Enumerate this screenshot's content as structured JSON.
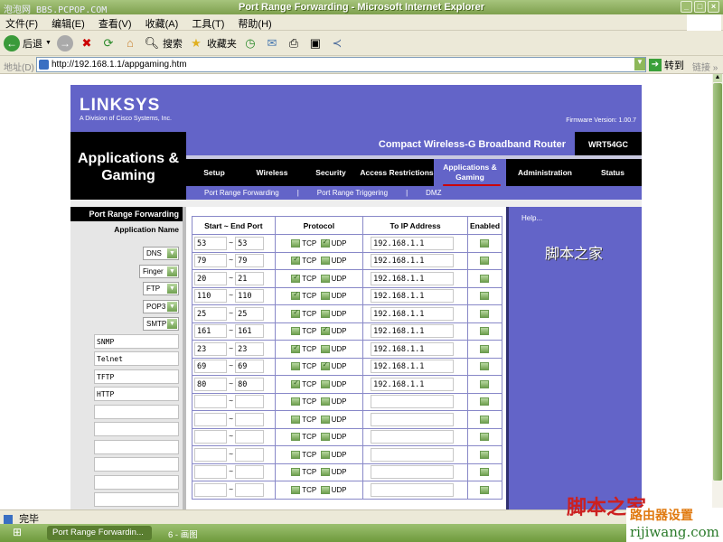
{
  "window": {
    "watermark": "泡泡网 BBS.PCPOP.COM",
    "title": "Port Range Forwarding - Microsoft Internet Explorer",
    "controls": [
      "minimize",
      "maximize",
      "close"
    ]
  },
  "menu": [
    "文件(F)",
    "编辑(E)",
    "查看(V)",
    "收藏(A)",
    "工具(T)",
    "帮助(H)"
  ],
  "toolbar": {
    "back": "后退",
    "search": "搜索",
    "favorites": "收藏夹"
  },
  "address": {
    "label": "地址(D)",
    "url": "http://192.168.1.1/appgaming.htm",
    "go": "转到",
    "links": "链接 »"
  },
  "router": {
    "logo": "LINKSYS",
    "logo_sub": "A Division of Cisco Systems, Inc.",
    "firmware": "Firmware Version: 1.00.7",
    "section_title": "Applications & Gaming",
    "product": "Compact Wireless-G Broadband Router",
    "model": "WRT54GC",
    "nav": [
      "Setup",
      "Wireless",
      "Security",
      "Access Restrictions",
      "Applications & Gaming",
      "Administration",
      "Status"
    ],
    "nav_active": "Applications & Gaming",
    "subnav": [
      "Port Range Forwarding",
      "Port Range Triggering",
      "DMZ"
    ],
    "subnav_active": "Port Range Forwarding",
    "left_header": "Port Range Forwarding",
    "app_name_label": "Application Name",
    "help": "Help...",
    "help_watermark": "脚本之家"
  },
  "table": {
    "headers": [
      "Start ~ End Port",
      "Protocol",
      "To IP Address",
      "Enabled"
    ],
    "tcp_label": "TCP",
    "udp_label": "UDP",
    "rows": [
      {
        "app": "DNS",
        "type": "select",
        "start": "53",
        "end": "53",
        "tcp": false,
        "udp": true,
        "ip": "192.168.1.1",
        "enabled": false
      },
      {
        "app": "Finger",
        "type": "select",
        "start": "79",
        "end": "79",
        "tcp": true,
        "udp": false,
        "ip": "192.168.1.1",
        "enabled": false
      },
      {
        "app": "FTP",
        "type": "select",
        "start": "20",
        "end": "21",
        "tcp": true,
        "udp": false,
        "ip": "192.168.1.1",
        "enabled": false
      },
      {
        "app": "POP3",
        "type": "select",
        "start": "110",
        "end": "110",
        "tcp": true,
        "udp": false,
        "ip": "192.168.1.1",
        "enabled": false
      },
      {
        "app": "SMTP",
        "type": "select",
        "start": "25",
        "end": "25",
        "tcp": true,
        "udp": false,
        "ip": "192.168.1.1",
        "enabled": false
      },
      {
        "app": "SNMP",
        "type": "text",
        "start": "161",
        "end": "161",
        "tcp": false,
        "udp": true,
        "ip": "192.168.1.1",
        "enabled": false
      },
      {
        "app": "Telnet",
        "type": "text",
        "start": "23",
        "end": "23",
        "tcp": true,
        "udp": false,
        "ip": "192.168.1.1",
        "enabled": false
      },
      {
        "app": "TFTP",
        "type": "text",
        "start": "69",
        "end": "69",
        "tcp": false,
        "udp": true,
        "ip": "192.168.1.1",
        "enabled": false
      },
      {
        "app": "HTTP",
        "type": "text",
        "start": "80",
        "end": "80",
        "tcp": true,
        "udp": false,
        "ip": "192.168.1.1",
        "enabled": false
      },
      {
        "app": "",
        "type": "text",
        "start": "",
        "end": "",
        "tcp": false,
        "udp": false,
        "ip": "",
        "enabled": false
      },
      {
        "app": "",
        "type": "text",
        "start": "",
        "end": "",
        "tcp": false,
        "udp": false,
        "ip": "",
        "enabled": false
      },
      {
        "app": "",
        "type": "text",
        "start": "",
        "end": "",
        "tcp": false,
        "udp": false,
        "ip": "",
        "enabled": false
      },
      {
        "app": "",
        "type": "text",
        "start": "",
        "end": "",
        "tcp": false,
        "udp": false,
        "ip": "",
        "enabled": false
      },
      {
        "app": "",
        "type": "text",
        "start": "",
        "end": "",
        "tcp": false,
        "udp": false,
        "ip": "",
        "enabled": false
      },
      {
        "app": "",
        "type": "text",
        "start": "",
        "end": "",
        "tcp": false,
        "udp": false,
        "ip": "",
        "enabled": false
      }
    ]
  },
  "status": {
    "text": "完毕"
  },
  "taskbar": {
    "active_task": "Port Range Forwardin...",
    "task2": "6 - 画图"
  },
  "watermarks": {
    "brand": "脚本之家",
    "site_cn": "路由器设置",
    "site_en": "rijiwang.com"
  }
}
